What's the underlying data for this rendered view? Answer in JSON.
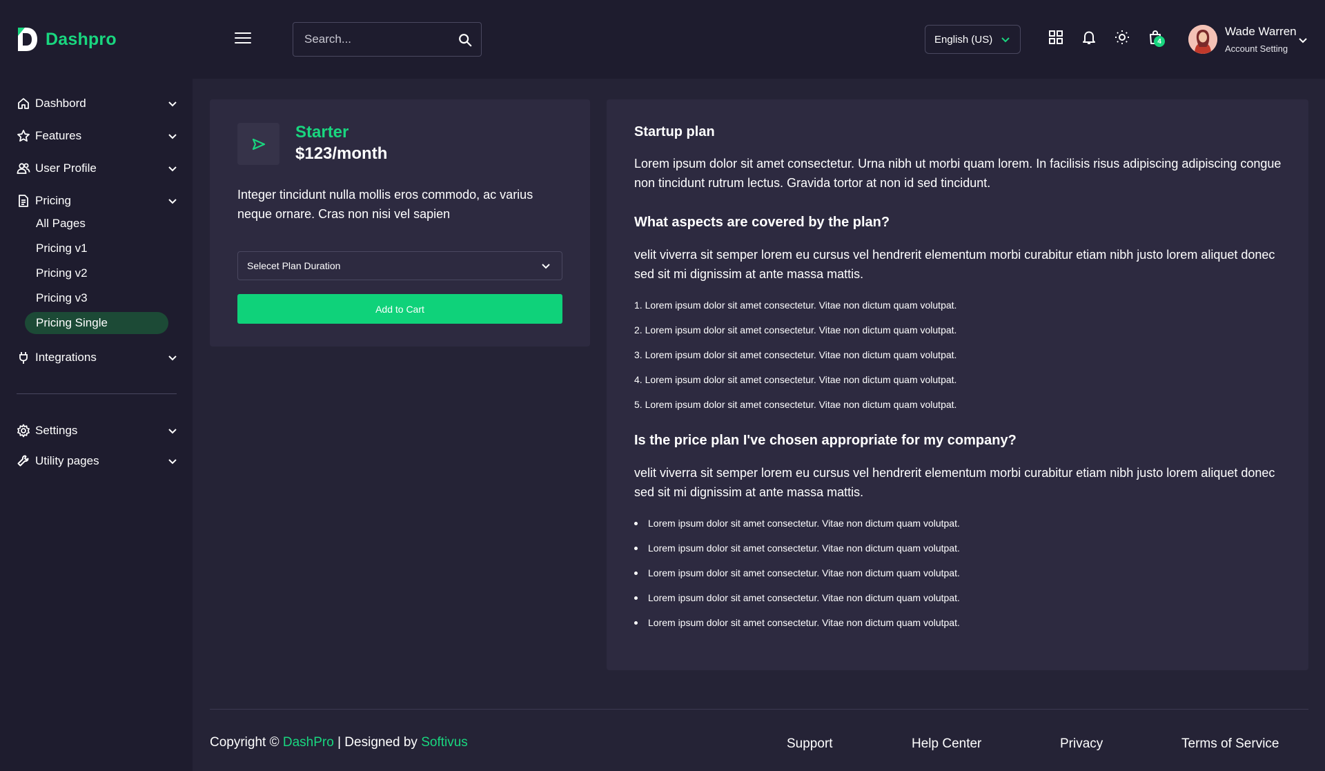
{
  "brand": {
    "name": "Dashpro"
  },
  "header": {
    "search_placeholder": "Search...",
    "language": "English (US)",
    "cart_count": "4",
    "user_name": "Wade Warren",
    "user_sub": "Account Setting"
  },
  "sidebar": {
    "items": [
      {
        "label": "Dashbord",
        "icon": "home-icon"
      },
      {
        "label": "Features",
        "icon": "star-icon"
      },
      {
        "label": "User Profile",
        "icon": "users-icon"
      },
      {
        "label": "Pricing",
        "icon": "document-icon"
      },
      {
        "label": "Integrations",
        "icon": "plug-icon"
      },
      {
        "label": "Settings",
        "icon": "gear-icon"
      },
      {
        "label": "Utility pages",
        "icon": "wrench-icon"
      }
    ],
    "pricing_sub": [
      "All Pages",
      "Pricing v1",
      "Pricing v2",
      "Pricing v3",
      "Pricing Single"
    ]
  },
  "plan": {
    "name": "Starter",
    "price": "$123/month",
    "description": "Integer tincidunt nulla mollis eros commodo, ac varius neque ornare. Cras non nisi vel sapien",
    "select_label": "Selecet Plan Duration",
    "add_to_cart": "Add to Cart"
  },
  "details": {
    "h1": "Startup plan",
    "p1": "Lorem ipsum dolor sit amet consectetur. Urna nibh ut morbi quam lorem. In facilisis risus adipiscing adipiscing congue non tincidunt rutrum lectus. Gravida tortor at non id sed tincidunt.",
    "h2": "What aspects are covered by the plan?",
    "p2": "velit viverra sit semper lorem eu cursus vel hendrerit elementum morbi curabitur etiam nibh justo lorem aliquet donec sed sit mi dignissim at ante massa mattis.",
    "ordered": [
      "1. Lorem ipsum dolor sit amet consectetur. Vitae non dictum quam volutpat.",
      "2. Lorem ipsum dolor sit amet consectetur. Vitae non dictum quam volutpat.",
      "3. Lorem ipsum dolor sit amet consectetur. Vitae non dictum quam volutpat.",
      "4. Lorem ipsum dolor sit amet consectetur. Vitae non dictum quam volutpat.",
      "5. Lorem ipsum dolor sit amet consectetur. Vitae non dictum quam volutpat."
    ],
    "h3": "Is the price plan I've chosen appropriate for my company?",
    "p3": "velit viverra sit semper lorem eu cursus vel hendrerit elementum morbi curabitur etiam nibh justo lorem aliquet donec sed sit mi dignissim at ante massa mattis.",
    "bullets": [
      "Lorem ipsum dolor sit amet consectetur. Vitae non dictum quam volutpat.",
      "Lorem ipsum dolor sit amet consectetur. Vitae non dictum quam volutpat.",
      "Lorem ipsum dolor sit amet consectetur. Vitae non dictum quam volutpat.",
      "Lorem ipsum dolor sit amet consectetur. Vitae non dictum quam volutpat.",
      "Lorem ipsum dolor sit amet consectetur. Vitae non dictum quam volutpat."
    ]
  },
  "footer": {
    "copy_prefix": "Copyright ©",
    "copy_brand": "DashPro",
    "copy_mid": "| Designed by",
    "copy_designer": "Softivus",
    "links": [
      "Support",
      "Help Center",
      "Privacy",
      "Terms of Service"
    ]
  },
  "colors": {
    "accent": "#19d67f",
    "background": "#1e1c2e",
    "card": "#2d2a40"
  }
}
